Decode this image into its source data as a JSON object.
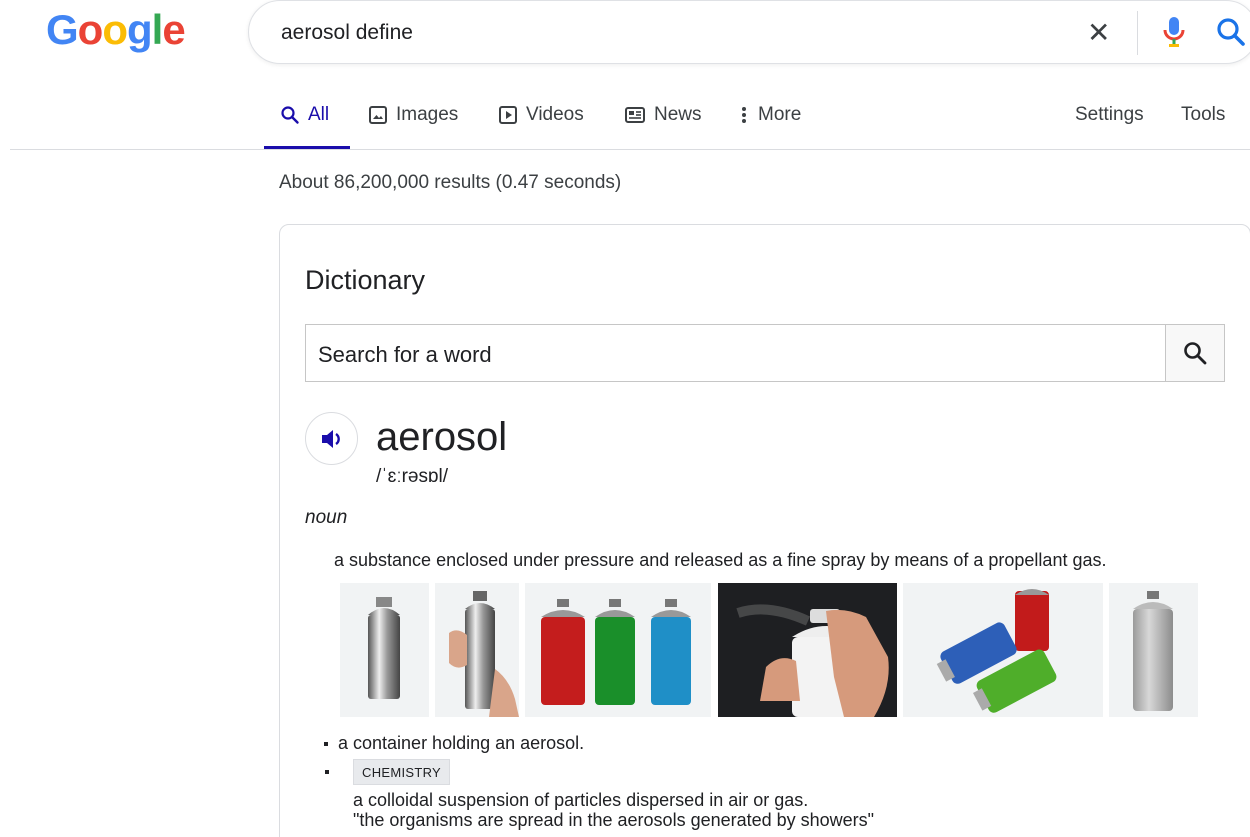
{
  "header": {
    "logo_letters": [
      "G",
      "o",
      "o",
      "g",
      "l",
      "e"
    ],
    "logo_colors": [
      "#4285F4",
      "#EA4335",
      "#FBBC05",
      "#4285F4",
      "#34A853",
      "#EA4335"
    ],
    "query": "aerosol define"
  },
  "tabs": [
    {
      "label": "All",
      "icon": "search-icon"
    },
    {
      "label": "Images",
      "icon": "image-icon"
    },
    {
      "label": "Videos",
      "icon": "video-icon"
    },
    {
      "label": "News",
      "icon": "news-icon"
    },
    {
      "label": "More",
      "icon": "more-vert-icon"
    }
  ],
  "tabs_right": {
    "settings": "Settings",
    "tools": "Tools"
  },
  "stats": "About 86,200,000 results (0.47 seconds)",
  "dictionary": {
    "title": "Dictionary",
    "search_placeholder": "Search for a word",
    "word": "aerosol",
    "phonetic": "/ˈɛːrəsɒl/",
    "pos": "noun",
    "definitions": [
      "a substance enclosed under pressure and released as a fine spray by means of a propellant gas.",
      "a container holding an aerosol.",
      "a colloidal suspension of particles dispersed in air or gas."
    ],
    "label_chemistry": "CHEMISTRY",
    "example": "\"the organisms are spread in the aerosols generated by showers\"",
    "images": [
      "silver-aerosol-can",
      "hand-holding-aerosol-can",
      "red-green-blue-aerosol-cans",
      "hand-spraying-aerosol-can",
      "colored-aerosol-cans-group",
      "grey-aerosol-can"
    ]
  },
  "colors": {
    "accent": "#1a0dab",
    "mic_blue": "#4285F4",
    "mic_red": "#EA4335"
  }
}
